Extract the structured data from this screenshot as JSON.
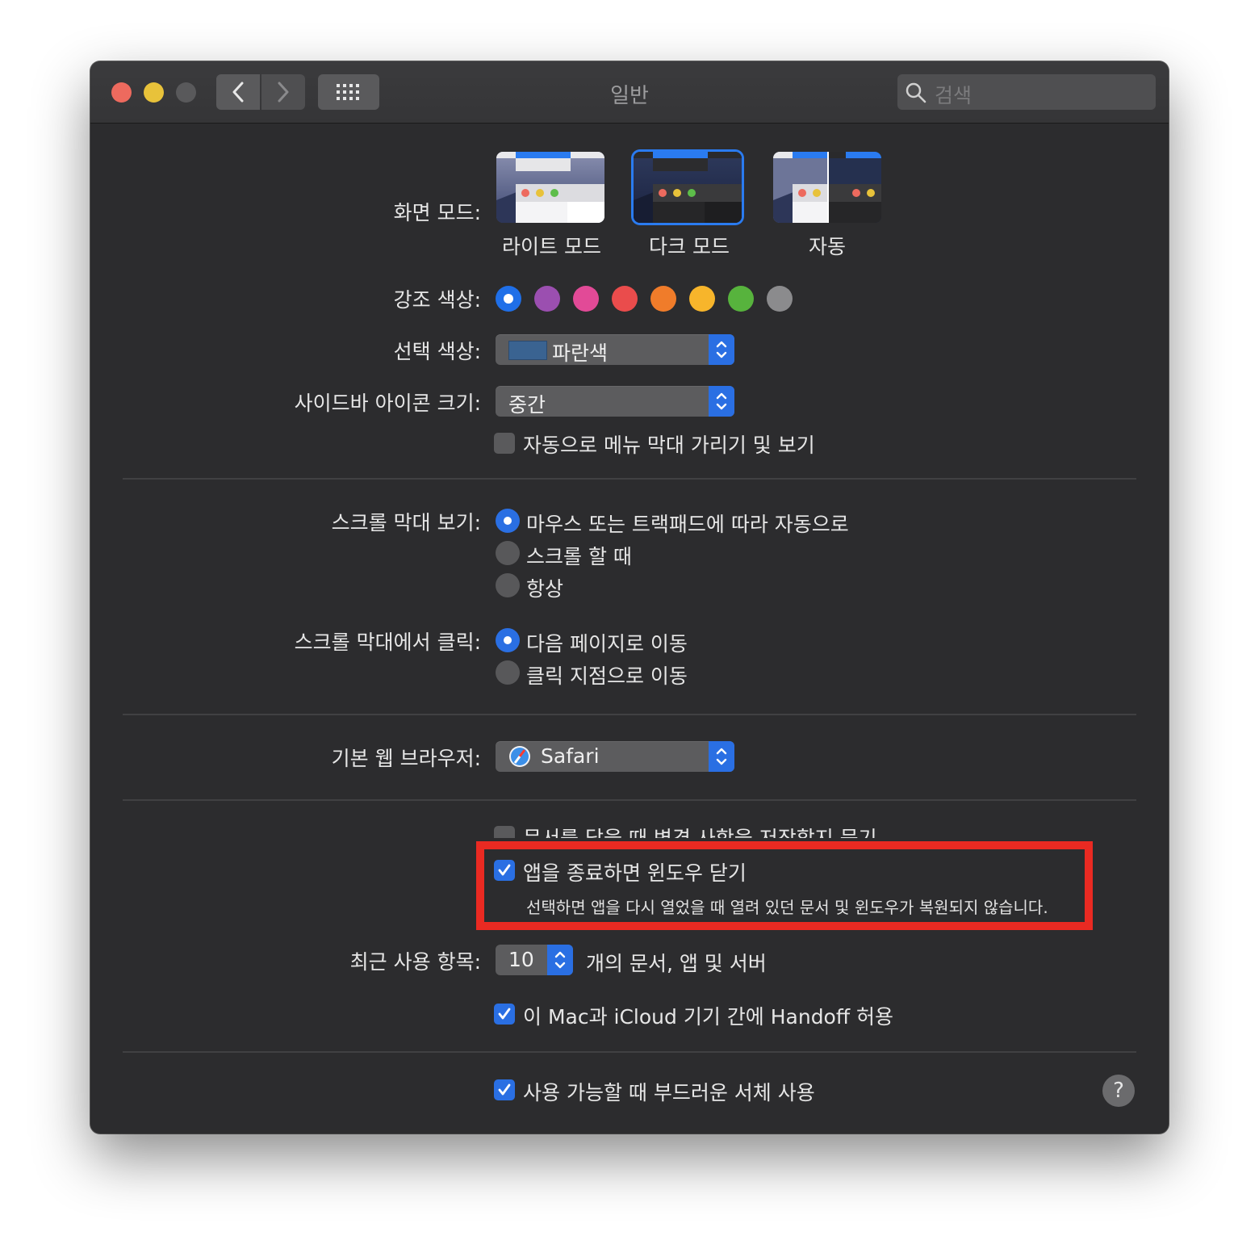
{
  "window": {
    "title": "일반"
  },
  "toolbar": {
    "search_placeholder": "검색"
  },
  "appearance": {
    "label": "화면 모드:",
    "modes": [
      {
        "label": "라이트 모드",
        "selected": false
      },
      {
        "label": "다크 모드",
        "selected": true
      },
      {
        "label": "자동",
        "selected": false
      }
    ]
  },
  "accent": {
    "label": "강조 색상:",
    "colors": [
      "#1f6fe8",
      "#9b4fb0",
      "#e24a97",
      "#ea4c4c",
      "#f07c2a",
      "#f7b52b",
      "#57b33d",
      "#8b8b8d"
    ],
    "selected_index": 0
  },
  "highlight_color": {
    "label": "선택 색상:",
    "value": "파란색",
    "swatch": "#3a6391"
  },
  "sidebar_icon": {
    "label": "사이드바 아이콘 크기:",
    "value": "중간"
  },
  "auto_hide_menu": {
    "label": "자동으로 메뉴 막대 가리기 및 보기",
    "checked": false
  },
  "show_scroll": {
    "label": "스크롤 막대 보기:",
    "options": [
      {
        "label": "마우스 또는 트랙패드에 따라 자동으로",
        "selected": true
      },
      {
        "label": "스크롤 할 때",
        "selected": false
      },
      {
        "label": "항상",
        "selected": false
      }
    ]
  },
  "click_scroll": {
    "label": "스크롤 막대에서 클릭:",
    "options": [
      {
        "label": "다음 페이지로 이동",
        "selected": true
      },
      {
        "label": "클릭 지점으로 이동",
        "selected": false
      }
    ]
  },
  "browser": {
    "label": "기본 웹 브라우저:",
    "value": "Safari"
  },
  "ask_keep_changes": {
    "label": "문서를 닫을 때 변경 사항을 저장할지 묻기",
    "checked": false
  },
  "close_windows": {
    "label": "앱을 종료하면 윈도우 닫기",
    "checked": true,
    "description": "선택하면 앱을 다시 열었을 때 열려 있던 문서 및 윈도우가 복원되지 않습니다."
  },
  "recent_items": {
    "label": "최근 사용 항목:",
    "value": "10",
    "suffix": "개의 문서, 앱 및 서버"
  },
  "handoff": {
    "label": "이 Mac과 iCloud 기기 간에 Handoff 허용",
    "checked": true
  },
  "font_smoothing": {
    "label": "사용 가능할 때 부드러운 서체 사용",
    "checked": true
  },
  "help": {
    "label": "?"
  }
}
